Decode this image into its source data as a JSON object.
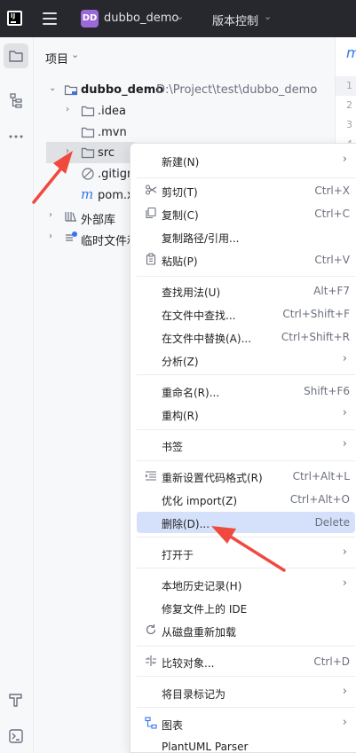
{
  "titlebar": {
    "project_badge": "DD",
    "project_name": "dubbo_demo",
    "vcs_label": "版本控制"
  },
  "toolwindow": {
    "title": "项目"
  },
  "tree": {
    "root_name": "dubbo_demo",
    "root_path": "D:\\Project\\test\\dubbo_demo",
    "items": [
      {
        "label": "dubbo_demo",
        "type": "root"
      },
      {
        "label": ".idea",
        "type": "folder"
      },
      {
        "label": ".mvn",
        "type": "folder"
      },
      {
        "label": "src",
        "type": "folder"
      },
      {
        "label": ".gitign",
        "type": "gitignore"
      },
      {
        "label": "pom.x",
        "type": "maven"
      },
      {
        "label": "外部库",
        "type": "library"
      },
      {
        "label": "临时文件和",
        "type": "scratch"
      }
    ]
  },
  "editor": {
    "tab_glyph": "m",
    "line_numbers": [
      "1",
      "2",
      "3",
      "4"
    ]
  },
  "menu": {
    "items": [
      {
        "label": "新建(N)",
        "shortcut": "",
        "submenu": true,
        "icon": ""
      },
      {
        "label": "剪切(T)",
        "shortcut": "Ctrl+X",
        "submenu": false,
        "icon": "scissors-icon"
      },
      {
        "label": "复制(C)",
        "shortcut": "Ctrl+C",
        "submenu": false,
        "icon": "copy-icon"
      },
      {
        "label": "复制路径/引用...",
        "shortcut": "",
        "submenu": false,
        "icon": ""
      },
      {
        "label": "粘贴(P)",
        "shortcut": "Ctrl+V",
        "submenu": false,
        "icon": "paste-icon"
      },
      {
        "label": "查找用法(U)",
        "shortcut": "Alt+F7",
        "submenu": false,
        "icon": ""
      },
      {
        "label": "在文件中查找...",
        "shortcut": "Ctrl+Shift+F",
        "submenu": false,
        "icon": ""
      },
      {
        "label": "在文件中替换(A)...",
        "shortcut": "Ctrl+Shift+R",
        "submenu": false,
        "icon": ""
      },
      {
        "label": "分析(Z)",
        "shortcut": "",
        "submenu": true,
        "icon": ""
      },
      {
        "label": "重命名(R)...",
        "shortcut": "Shift+F6",
        "submenu": false,
        "icon": ""
      },
      {
        "label": "重构(R)",
        "shortcut": "",
        "submenu": true,
        "icon": ""
      },
      {
        "label": "书签",
        "shortcut": "",
        "submenu": true,
        "icon": ""
      },
      {
        "label": "重新设置代码格式(R)",
        "shortcut": "Ctrl+Alt+L",
        "submenu": false,
        "icon": "reformat-icon"
      },
      {
        "label": "优化 import(Z)",
        "shortcut": "Ctrl+Alt+O",
        "submenu": false,
        "icon": ""
      },
      {
        "label": "删除(D)...",
        "shortcut": "Delete",
        "submenu": false,
        "icon": ""
      },
      {
        "label": "打开于",
        "shortcut": "",
        "submenu": true,
        "icon": ""
      },
      {
        "label": "本地历史记录(H)",
        "shortcut": "",
        "submenu": true,
        "icon": ""
      },
      {
        "label": "修复文件上的 IDE",
        "shortcut": "",
        "submenu": false,
        "icon": ""
      },
      {
        "label": "从磁盘重新加载",
        "shortcut": "",
        "submenu": false,
        "icon": "reload-icon"
      },
      {
        "label": "比较对象...",
        "shortcut": "Ctrl+D",
        "submenu": false,
        "icon": "compare-icon"
      },
      {
        "label": "将目录标记为",
        "shortcut": "",
        "submenu": true,
        "icon": ""
      },
      {
        "label": "图表",
        "shortcut": "",
        "submenu": true,
        "icon": "diagram-icon"
      },
      {
        "label": "PlantUML Parser",
        "shortcut": "",
        "submenu": false,
        "icon": ""
      }
    ],
    "highlighted_item": "删除(D)..."
  },
  "colors": {
    "titlebar_bg": "#27282e",
    "selection": "#d5e1fa",
    "accent": "#3574f0",
    "annotation_red": "#f04a3f",
    "project_badge": "#9c6ad6"
  }
}
